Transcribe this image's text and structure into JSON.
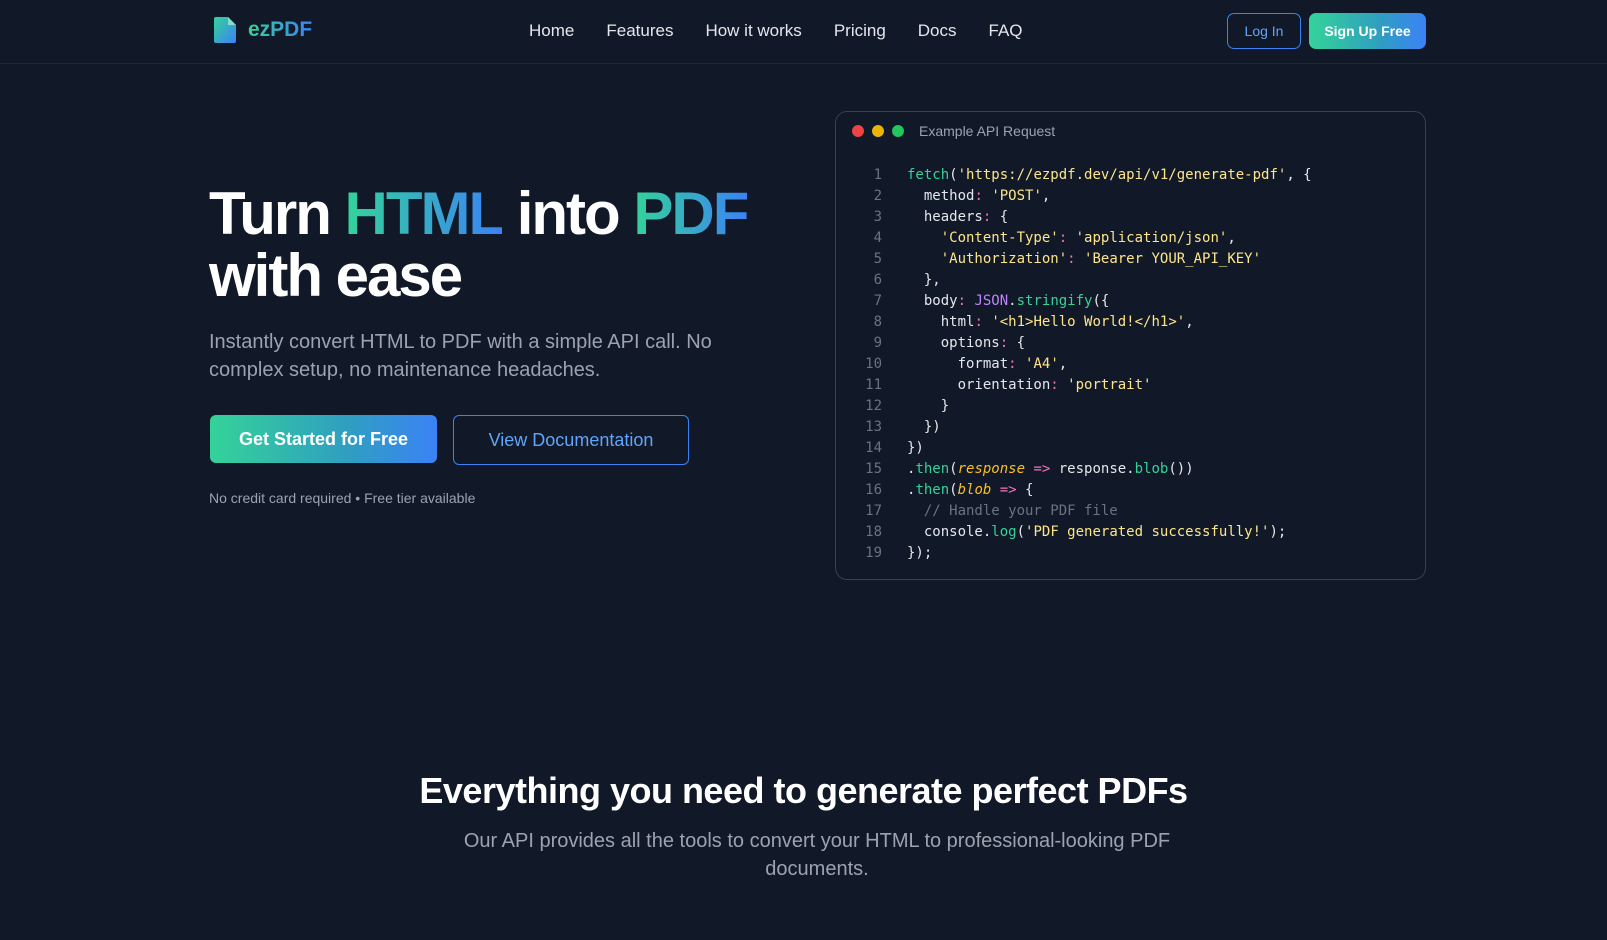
{
  "brand": {
    "name": "ezPDF",
    "icon": "file-icon"
  },
  "nav": {
    "links": [
      "Home",
      "Features",
      "How it works",
      "Pricing",
      "Docs",
      "FAQ"
    ],
    "login_label": "Log In",
    "signup_label": "Sign Up Free"
  },
  "hero": {
    "title_part1": "Turn ",
    "title_html": "HTML",
    "title_part2": " into ",
    "title_pdf": "PDF",
    "title_part3": "with ease",
    "subtitle": "Instantly convert HTML to PDF with a simple API call. No complex setup, no maintenance headaches.",
    "primary_cta": "Get Started for Free",
    "secondary_cta": "View Documentation",
    "note": "No credit card required • Free tier available"
  },
  "code_card": {
    "title": "Example API Request",
    "window_dots": [
      "#ef4444",
      "#eab308",
      "#22c55e"
    ],
    "lines": [
      [
        [
          "fn",
          "fetch"
        ],
        [
          "p",
          "("
        ],
        [
          "str",
          "'https://ezpdf.dev/api/v1/generate-pdf'"
        ],
        [
          "p",
          ", {"
        ]
      ],
      [
        [
          "p",
          "  "
        ],
        [
          "key",
          "method"
        ],
        [
          "op",
          ":"
        ],
        [
          "p",
          " "
        ],
        [
          "str",
          "'POST'"
        ],
        [
          "p",
          ","
        ]
      ],
      [
        [
          "p",
          "  "
        ],
        [
          "key",
          "headers"
        ],
        [
          "op",
          ":"
        ],
        [
          "p",
          " {"
        ]
      ],
      [
        [
          "p",
          "    "
        ],
        [
          "str",
          "'Content-Type'"
        ],
        [
          "op",
          ":"
        ],
        [
          "p",
          " "
        ],
        [
          "str",
          "'application/json'"
        ],
        [
          "p",
          ","
        ]
      ],
      [
        [
          "p",
          "    "
        ],
        [
          "str",
          "'Authorization'"
        ],
        [
          "op",
          ":"
        ],
        [
          "p",
          " "
        ],
        [
          "str",
          "'Bearer YOUR_API_KEY'"
        ]
      ],
      [
        [
          "p",
          "  },"
        ]
      ],
      [
        [
          "p",
          "  "
        ],
        [
          "key",
          "body"
        ],
        [
          "op",
          ":"
        ],
        [
          "p",
          " "
        ],
        [
          "kw",
          "JSON"
        ],
        [
          "p",
          "."
        ],
        [
          "fn",
          "stringify"
        ],
        [
          "p",
          "({"
        ]
      ],
      [
        [
          "p",
          "    "
        ],
        [
          "key",
          "html"
        ],
        [
          "op",
          ":"
        ],
        [
          "p",
          " "
        ],
        [
          "str",
          "'<h1>Hello World!</h1>'"
        ],
        [
          "p",
          ","
        ]
      ],
      [
        [
          "p",
          "    "
        ],
        [
          "key",
          "options"
        ],
        [
          "op",
          ":"
        ],
        [
          "p",
          " {"
        ]
      ],
      [
        [
          "p",
          "      "
        ],
        [
          "key",
          "format"
        ],
        [
          "op",
          ":"
        ],
        [
          "p",
          " "
        ],
        [
          "str",
          "'A4'"
        ],
        [
          "p",
          ","
        ]
      ],
      [
        [
          "p",
          "      "
        ],
        [
          "key",
          "orientation"
        ],
        [
          "op",
          ":"
        ],
        [
          "p",
          " "
        ],
        [
          "str",
          "'portrait'"
        ]
      ],
      [
        [
          "p",
          "    }"
        ]
      ],
      [
        [
          "p",
          "  })"
        ]
      ],
      [
        [
          "p",
          "})"
        ]
      ],
      [
        [
          "p",
          "."
        ],
        [
          "fn",
          "then"
        ],
        [
          "p",
          "("
        ],
        [
          "param",
          "response"
        ],
        [
          "p",
          " "
        ],
        [
          "op",
          "=>"
        ],
        [
          "p",
          " response."
        ],
        [
          "fn",
          "blob"
        ],
        [
          "p",
          "())"
        ]
      ],
      [
        [
          "p",
          "."
        ],
        [
          "fn",
          "then"
        ],
        [
          "p",
          "("
        ],
        [
          "param",
          "blob"
        ],
        [
          "p",
          " "
        ],
        [
          "op",
          "=>"
        ],
        [
          "p",
          " {"
        ]
      ],
      [
        [
          "p",
          "  "
        ],
        [
          "cm",
          "// Handle your PDF file"
        ]
      ],
      [
        [
          "p",
          "  console."
        ],
        [
          "fn",
          "log"
        ],
        [
          "p",
          "("
        ],
        [
          "str",
          "'PDF generated successfully!'"
        ],
        [
          "p",
          ");"
        ]
      ],
      [
        [
          "p",
          "});"
        ]
      ]
    ]
  },
  "features": {
    "title": "Everything you need to generate perfect PDFs",
    "subtitle": "Our API provides all the tools to convert your HTML to professional-looking PDF documents."
  },
  "colors": {
    "background": "#111827",
    "accent_green": "#34d399",
    "accent_blue": "#3b82f6"
  }
}
